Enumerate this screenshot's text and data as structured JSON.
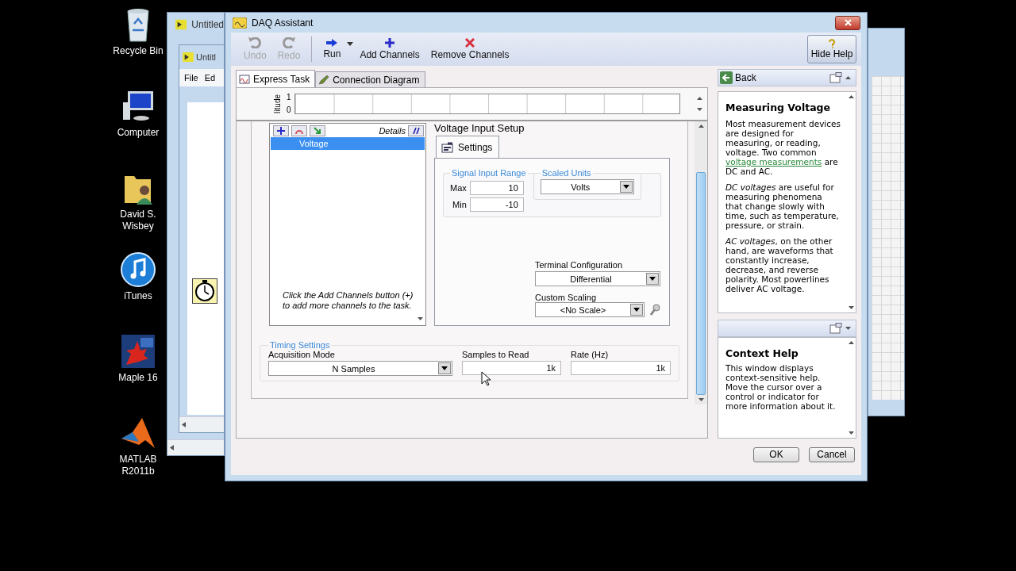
{
  "desktop_icons": [
    {
      "label": "Recycle Bin",
      "kind": "recycle"
    },
    {
      "label": "Computer",
      "kind": "computer"
    },
    {
      "label": "David S. Wisbey",
      "kind": "folder"
    },
    {
      "label": "iTunes",
      "kind": "itunes"
    },
    {
      "label": "Maple 16",
      "kind": "maple"
    },
    {
      "label": "MATLAB R2011b",
      "kind": "matlab"
    }
  ],
  "back_window": {
    "title": "Untitled"
  },
  "inner_window": {
    "title": "Untitl",
    "menu": [
      "File",
      "Ed"
    ]
  },
  "dialog": {
    "title": "DAQ Assistant",
    "toolbar": [
      {
        "label": "Undo",
        "kind": "undo",
        "disabled": true
      },
      {
        "label": "Redo",
        "kind": "redo",
        "disabled": true
      },
      {
        "label": "Run",
        "kind": "run",
        "disabled": false
      },
      {
        "label": "Add Channels",
        "kind": "add",
        "disabled": false
      },
      {
        "label": "Remove Channels",
        "kind": "remove",
        "disabled": false
      }
    ],
    "hide_help": "Hide Help",
    "tabs": [
      {
        "label": "Express Task",
        "selected": true
      },
      {
        "label": "Connection Diagram",
        "selected": false
      }
    ],
    "graph": {
      "axis_label": "litude",
      "ticks": [
        "1",
        "0"
      ]
    },
    "channels": {
      "details_label": "Details",
      "items": [
        {
          "name": "Voltage",
          "selected": true
        }
      ],
      "hint": "Click the Add Channels button (+) to add more channels to the task."
    },
    "setup": {
      "title": "Voltage Input Setup",
      "tab": "Settings",
      "signal_range": {
        "legend": "Signal Input Range",
        "max_label": "Max",
        "max": "10",
        "min_label": "Min",
        "min": "-10"
      },
      "scaled_units": {
        "legend": "Scaled Units",
        "value": "Volts"
      },
      "terminal": {
        "label": "Terminal Configuration",
        "value": "Differential"
      },
      "scaling": {
        "label": "Custom Scaling",
        "value": "<No Scale>"
      }
    },
    "timing": {
      "legend": "Timing Settings",
      "mode": {
        "label": "Acquisition Mode",
        "value": "N Samples"
      },
      "samples": {
        "label": "Samples to Read",
        "value": "1k"
      },
      "rate": {
        "label": "Rate (Hz)",
        "value": "1k"
      }
    },
    "help": {
      "back": "Back",
      "title": "Measuring Voltage",
      "intro": "Most measurement devices are designed for measuring, or reading, voltage. Two common",
      "link": "voltage measurements",
      "intro_end": "are DC and AC.",
      "paragraphs": [
        "*DC voltages* are useful for measuring phenomena that change slowly with time, such as temperature, pressure, or strain.",
        "*AC voltages*, on the other hand, are waveforms that constantly increase, decrease, and reverse polarity. Most powerlines deliver AC voltage."
      ]
    },
    "context_help": {
      "title": "Context Help",
      "text": "This window displays context-sensitive help. Move the cursor over a control or indicator for more information about it."
    },
    "buttons": [
      "OK",
      "Cancel"
    ]
  }
}
